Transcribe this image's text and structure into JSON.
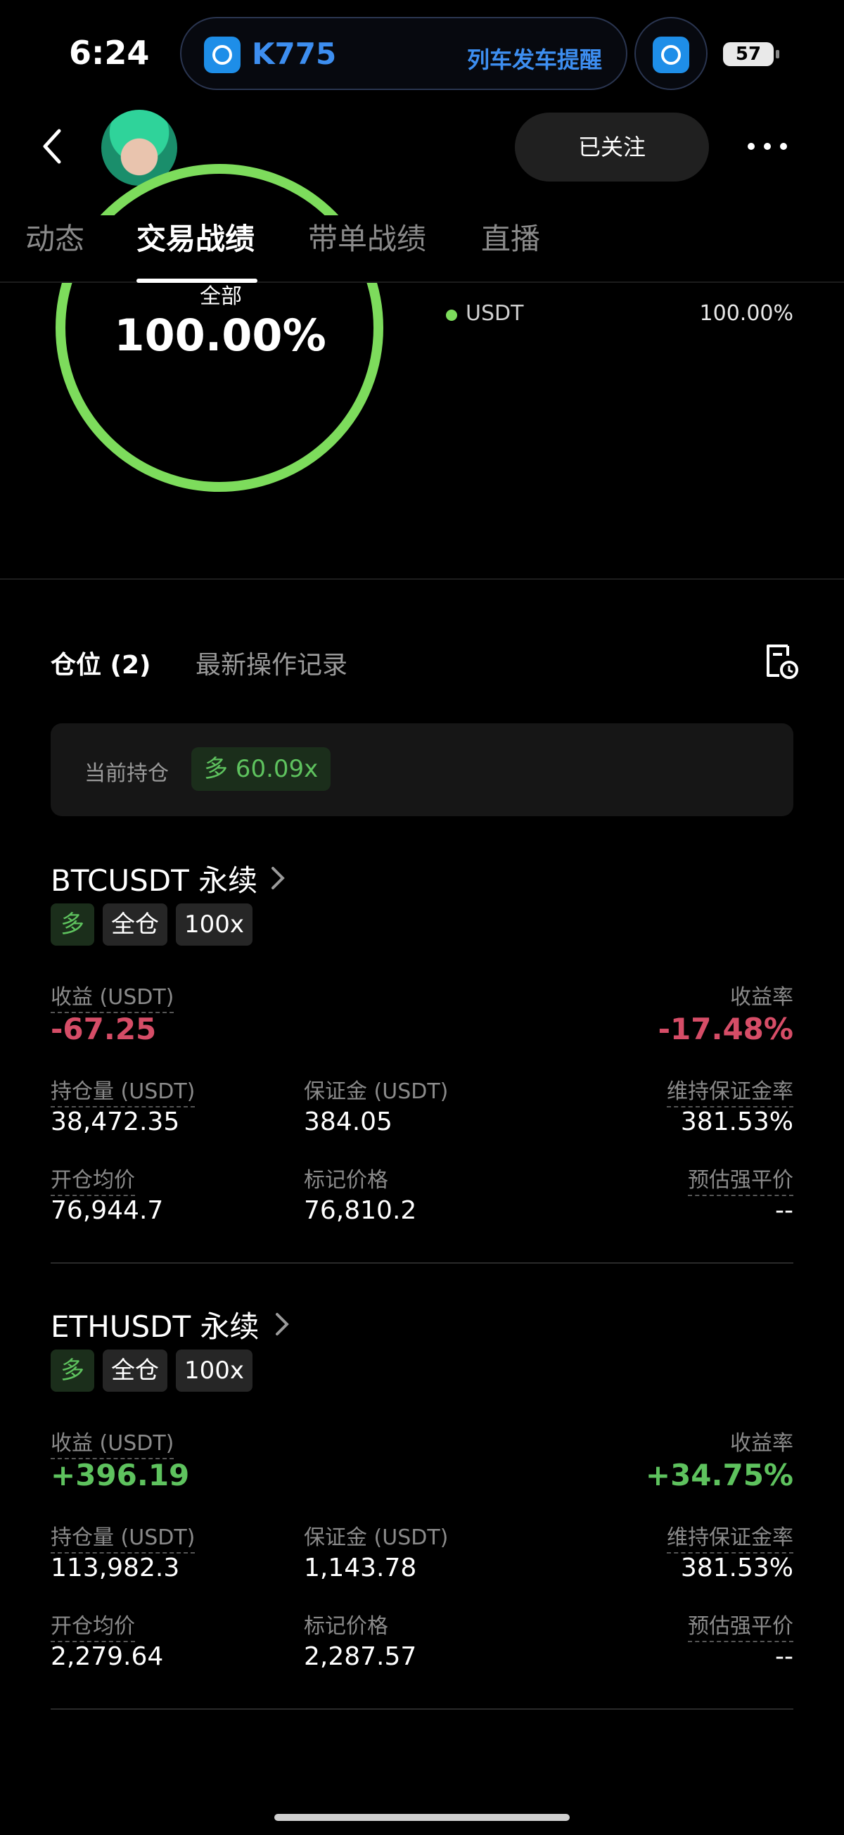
{
  "status_bar": {
    "time": "6:24",
    "train_number": "K775",
    "train_reminder": "列车发车提醒",
    "battery": "57"
  },
  "header": {
    "follow_label": "已关注"
  },
  "tabs": [
    {
      "label": "动态"
    },
    {
      "label": "交易战绩"
    },
    {
      "label": "带单战绩"
    },
    {
      "label": "直播"
    }
  ],
  "allocation": {
    "center_label": "全部",
    "center_value": "100.00%",
    "legend": [
      {
        "name": "USDT",
        "value": "100.00%",
        "color": "#7ddc5c",
        "fraction": 1.0
      }
    ]
  },
  "positions_tabs": {
    "positions": "仓位 (2)",
    "latest_ops": "最新操作记录"
  },
  "current_holding": {
    "label": "当前持仓",
    "badge": "多 60.09x"
  },
  "cards": [
    {
      "title": "BTCUSDT 永续",
      "tags": [
        "多",
        "全仓",
        "100x"
      ],
      "pnl_label": "收益 (USDT)",
      "pnl_value": "-67.25",
      "roi_label": "收益率",
      "roi_value": "-17.48%",
      "size_label": "持仓量 (USDT)",
      "size_value": "38,472.35",
      "margin_label": "保证金 (USDT)",
      "margin_value": "384.05",
      "mmr_label": "维持保证金率",
      "mmr_value": "381.53%",
      "entry_label": "开仓均价",
      "entry_value": "76,944.7",
      "mark_label": "标记价格",
      "mark_value": "76,810.2",
      "liq_label": "预估强平价",
      "liq_value": "--"
    },
    {
      "title": "ETHUSDT 永续",
      "tags": [
        "多",
        "全仓",
        "100x"
      ],
      "pnl_label": "收益 (USDT)",
      "pnl_value": "+396.19",
      "roi_label": "收益率",
      "roi_value": "+34.75%",
      "size_label": "持仓量 (USDT)",
      "size_value": "113,982.3",
      "margin_label": "保证金 (USDT)",
      "margin_value": "1,143.78",
      "mmr_label": "维持保证金率",
      "mmr_value": "381.53%",
      "entry_label": "开仓均价",
      "entry_value": "2,279.64",
      "mark_label": "标记价格",
      "mark_value": "2,287.57",
      "liq_label": "预估强平价",
      "liq_value": "--"
    }
  ]
}
